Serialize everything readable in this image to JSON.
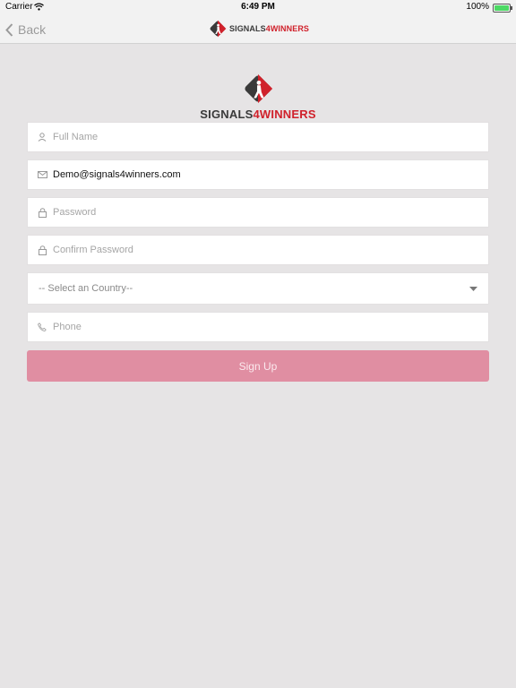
{
  "status_bar": {
    "carrier": "Carrier",
    "time": "6:49 PM",
    "battery": "100%"
  },
  "nav": {
    "back_label": "Back",
    "logo_text_a": "SIGNALS",
    "logo_text_b": "4WINNERS"
  },
  "logo": {
    "text_a": "SIGNALS",
    "text_b": "4WINNERS"
  },
  "form": {
    "full_name": {
      "placeholder": "Full Name",
      "value": ""
    },
    "email": {
      "placeholder": "Email",
      "value": "Demo@signals4winners.com"
    },
    "password": {
      "placeholder": "Password",
      "value": ""
    },
    "confirm_password": {
      "placeholder": "Confirm Password",
      "value": ""
    },
    "country": {
      "selected": "-- Select an Country--"
    },
    "phone": {
      "placeholder": "Phone",
      "value": ""
    },
    "submit_label": "Sign Up"
  },
  "colors": {
    "brand_red": "#d0212b",
    "button_pink": "#e08ea2",
    "background": "#e6e4e5"
  },
  "icons": [
    "wifi-icon",
    "battery-icon",
    "chevron-left-icon",
    "logo-icon",
    "user-icon",
    "mail-icon",
    "lock-icon",
    "caret-down-icon",
    "phone-icon"
  ]
}
